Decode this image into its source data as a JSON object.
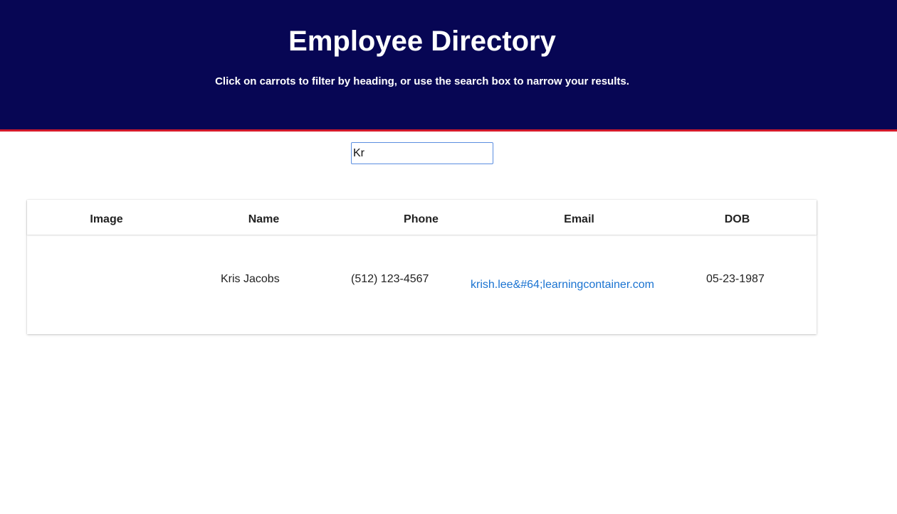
{
  "header": {
    "title": "Employee Directory",
    "subtitle": "Click on carrots to filter by heading, or use the search box to narrow your results."
  },
  "search": {
    "value": "Kr"
  },
  "table": {
    "columns": [
      "Image",
      "Name",
      "Phone",
      "Email",
      "DOB"
    ],
    "rows": [
      {
        "image": "",
        "name": "Kris Jacobs",
        "phone": "(512) 123-4567",
        "email": "krish.lee&#64;learningcontainer.com",
        "dob": "05-23-1987"
      }
    ]
  },
  "colors": {
    "header_bg": "#070654",
    "header_border": "#d41a2b",
    "link": "#1a73d1"
  }
}
